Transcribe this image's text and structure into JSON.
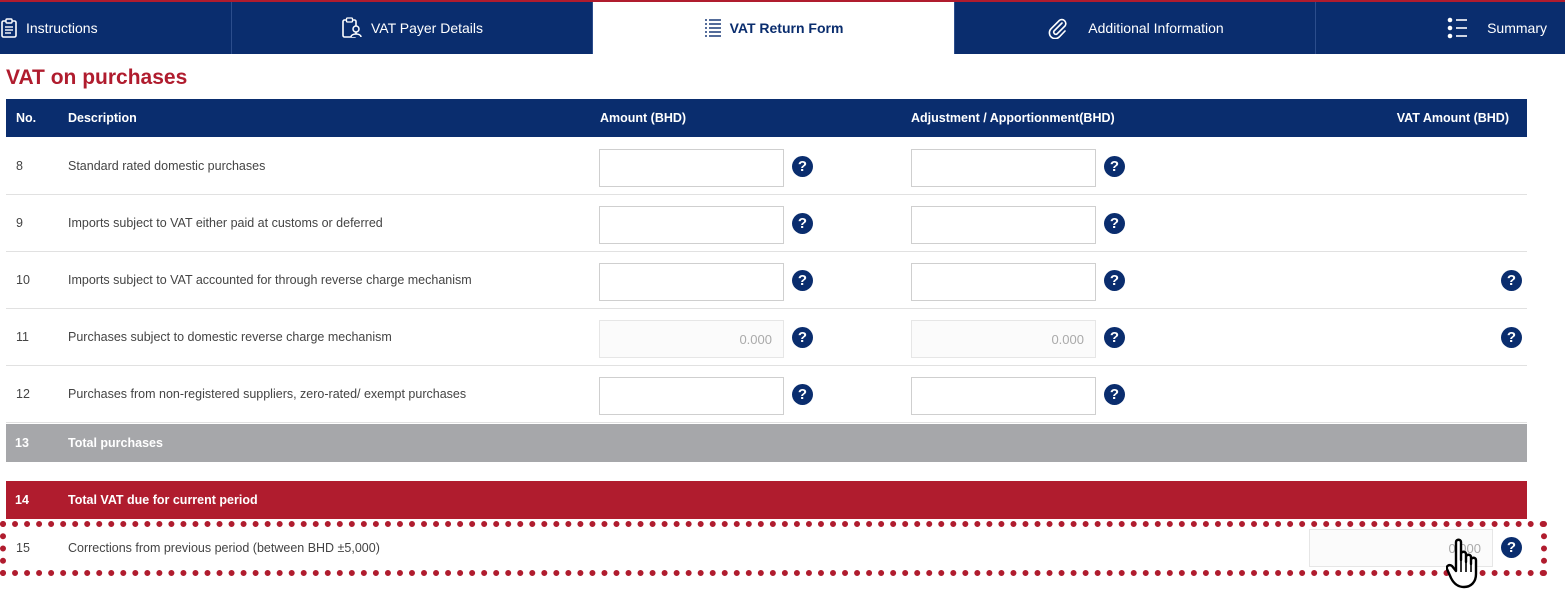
{
  "tabs": [
    {
      "label": "Instructions",
      "icon": "clipboard-icon",
      "active": false
    },
    {
      "label": "VAT Payer Details",
      "icon": "person-id-icon",
      "active": false
    },
    {
      "label": "VAT Return Form",
      "icon": "list-form-icon",
      "active": true
    },
    {
      "label": "Additional Information",
      "icon": "paperclip-icon",
      "active": false
    },
    {
      "label": "Summary",
      "icon": "bullet-list-icon",
      "active": false
    }
  ],
  "section_title": "VAT on purchases",
  "table": {
    "headers": {
      "no": "No.",
      "description": "Description",
      "amount": "Amount (BHD)",
      "adjustment": "Adjustment / Apportionment(BHD)",
      "vat_amount": "VAT Amount (BHD)"
    },
    "rows": [
      {
        "no": "8",
        "description": "Standard rated domestic purchases",
        "amount": "",
        "adjustment": ""
      },
      {
        "no": "9",
        "description": "Imports subject to VAT either paid at customs or deferred",
        "amount": "",
        "adjustment": ""
      },
      {
        "no": "10",
        "description": "Imports subject to VAT accounted for through reverse charge mechanism",
        "amount": "",
        "adjustment": ""
      },
      {
        "no": "11",
        "description": "Purchases subject to domestic reverse charge mechanism",
        "amount": "0.000",
        "adjustment": "0.000"
      },
      {
        "no": "12",
        "description": "Purchases from non-registered suppliers, zero-rated/ exempt purchases",
        "amount": "",
        "adjustment": ""
      }
    ],
    "total_purchases": {
      "no": "13",
      "label": "Total purchases"
    },
    "total_vat_due": {
      "no": "14",
      "label": "Total VAT due for current period"
    },
    "corrections": {
      "no": "15",
      "label": "Corrections from previous period (between BHD ±5,000)",
      "value": "0.000"
    }
  },
  "help_symbol": "?",
  "colors": {
    "navy": "#0a2d6e",
    "red": "#b01c2e",
    "grey": "#a6a7aa"
  }
}
